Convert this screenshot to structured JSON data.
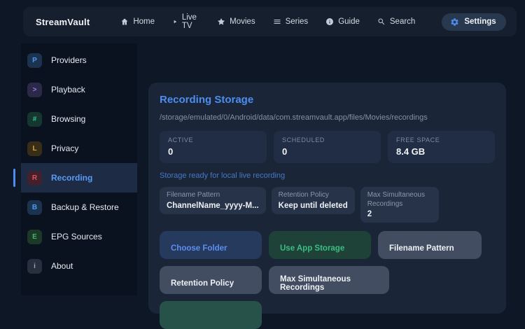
{
  "app": {
    "title": "StreamVault"
  },
  "topnav": {
    "items": [
      {
        "label": "Home",
        "icon": "home-icon"
      },
      {
        "label": "Live TV",
        "icon": "play-icon"
      },
      {
        "label": "Movies",
        "icon": "star-icon"
      },
      {
        "label": "Series",
        "icon": "list-icon"
      },
      {
        "label": "Guide",
        "icon": "info-icon"
      },
      {
        "label": "Search",
        "icon": "search-icon"
      }
    ],
    "active": {
      "label": "Settings",
      "icon": "gear-icon"
    }
  },
  "sidebar": {
    "items": [
      {
        "label": "Providers",
        "badge": "P",
        "selected": false
      },
      {
        "label": "Playback",
        "badge": ">",
        "selected": false
      },
      {
        "label": "Browsing",
        "badge": "#",
        "selected": false
      },
      {
        "label": "Privacy",
        "badge": "L",
        "selected": false
      },
      {
        "label": "Recording",
        "badge": "R",
        "selected": true
      },
      {
        "label": "Backup & Restore",
        "badge": "B",
        "selected": false
      },
      {
        "label": "EPG Sources",
        "badge": "E",
        "selected": false
      },
      {
        "label": "About",
        "badge": "i",
        "selected": false
      }
    ]
  },
  "main": {
    "title": "Recording Storage",
    "path": "/storage/emulated/0/Android/data/com.streamvault.app/files/Movies/recordings",
    "stats": [
      {
        "label": "ACTIVE",
        "value": "0"
      },
      {
        "label": "SCHEDULED",
        "value": "0"
      },
      {
        "label": "FREE SPACE",
        "value": "8.4 GB"
      }
    ],
    "status": "Storage ready for local live recording",
    "fields": [
      {
        "label": "Filename Pattern",
        "value": "ChannelName_yyyy-M..."
      },
      {
        "label": "Retention Policy",
        "value": "Keep until deleted"
      },
      {
        "label": "Max Simultaneous Recordings",
        "value": "2"
      }
    ],
    "buttons": [
      {
        "label": "Choose Folder"
      },
      {
        "label": "Use App Storage"
      },
      {
        "label": "Filename Pattern"
      },
      {
        "label": "Retention Policy"
      },
      {
        "label": "Max Simultaneous Recordings"
      }
    ]
  },
  "colors": {
    "accent_blue": "#4d8df0",
    "accent_green": "#3dbd84",
    "selected_item_bg": "#1d2b44",
    "panel_bg": "#1a2537",
    "page_bg": "#0e1725",
    "topbar_bg": "#161f2e",
    "sidebar_bg": "#0a1220",
    "badge_red": "#e0525e",
    "badge_purple": "#8f7ff2",
    "badge_teal": "#32c39a",
    "badge_amber": "#d3a43c"
  }
}
